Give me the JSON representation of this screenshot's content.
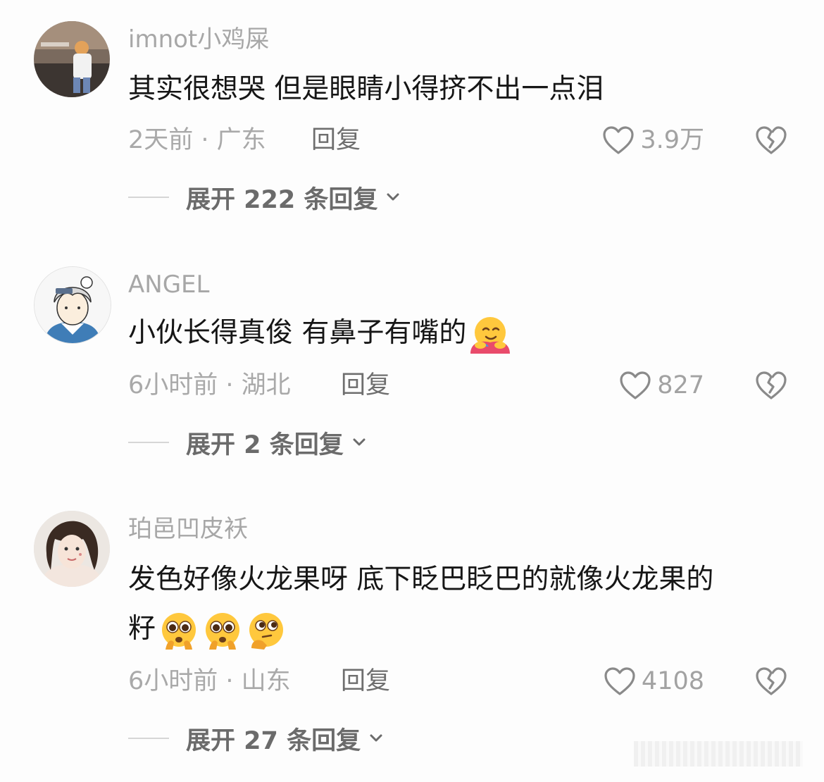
{
  "comments": [
    {
      "username": "imnot小鸡屎",
      "text": "其实很想哭 但是眼睛小得挤不出一点泪",
      "time_location": "2天前 · 广东",
      "reply_label": "回复",
      "likes": "3.9万",
      "expand_label": "展开 222 条回复"
    },
    {
      "username": "ANGEL",
      "text": "小伙长得真俊  有鼻子有嘴的",
      "emojis": [
        "hugging-face-emoji"
      ],
      "time_location": "6小时前 · 湖北",
      "reply_label": "回复",
      "likes": "827",
      "expand_label": "展开 2 条回复"
    },
    {
      "username": "珀邑凹皮袄",
      "text_line1": "发色好像火龙果呀 底下眨巴眨巴的就像火龙果的",
      "text_line2": "籽",
      "emojis": [
        "pleading-face-emoji",
        "pleading-face-emoji",
        "thinking-face-emoji"
      ],
      "time_location": "6小时前 · 山东",
      "reply_label": "回复",
      "likes": "4108",
      "expand_label": "展开 27 条回复"
    }
  ],
  "colors": {
    "background": "#fdfdfd",
    "username": "#a7a7a7",
    "text": "#161616",
    "meta": "#a9a9a9",
    "icon": "#8a8a8a"
  }
}
